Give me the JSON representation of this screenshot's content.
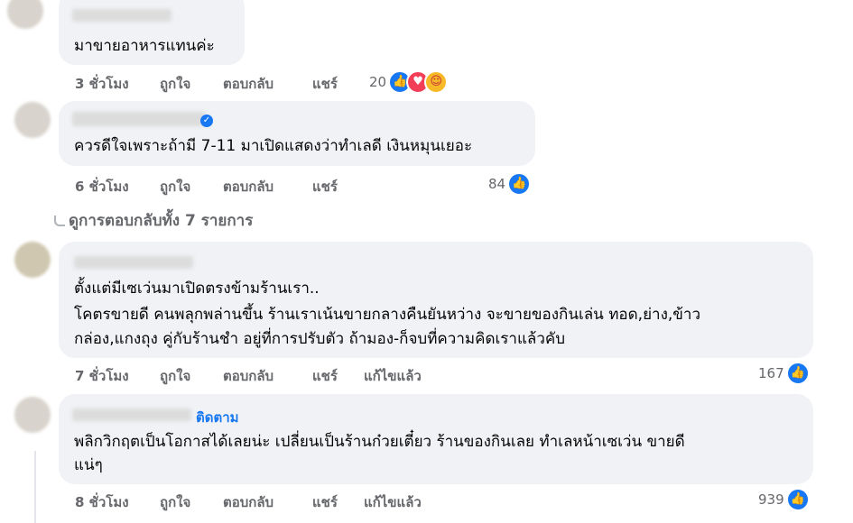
{
  "colors": {
    "link": "#1877f2",
    "muted": "#65676b",
    "bubble": "#f0f2f5",
    "like": "#1877f2",
    "love": "#f33e58",
    "care": "#f7b928"
  },
  "comments": [
    {
      "text_lines": [
        "มาขายอาหารแทนค่ะ"
      ],
      "actions": {
        "time": "3 ชั่วโมง",
        "like": "ถูกใจ",
        "reply": "ตอบกลับ",
        "share": "แชร์"
      },
      "reactions": {
        "count": "20",
        "icons": [
          "like-icon",
          "love-icon",
          "care-icon"
        ]
      }
    },
    {
      "text_lines": [
        "ควรดีใจเพราะถ้ามี 7-11 มาเปิดแสดงว่าทำเลดี เงินหมุนเยอะ"
      ],
      "actions": {
        "time": "6 ชั่วโมง",
        "like": "ถูกใจ",
        "reply": "ตอบกลับ",
        "share": "แชร์"
      },
      "reactions": {
        "count": "84",
        "icons": [
          "like-icon"
        ]
      }
    },
    {
      "text_lines": [
        "ตั้งแต่มีเซเว่นมาเปิดตรงข้ามร้านเรา..",
        "โคตรขายดี คนพลุกพล่านขึ้น ร้านเราเน้นขายกลางคืนยันหว่าง จะขายของกินเล่น ทอด,ย่าง,ข้าว",
        "กล่อง,แกงถุง คู่กับร้านชำ อยู่ที่การปรับตัว ถ้ามอง-ก็จบที่ความคิดเราแล้วคับ"
      ],
      "actions": {
        "time": "7 ชั่วโมง",
        "like": "ถูกใจ",
        "reply": "ตอบกลับ",
        "share": "แชร์",
        "edited": "แก้ไขแล้ว"
      },
      "reactions": {
        "count": "167",
        "icons": [
          "like-icon"
        ]
      }
    },
    {
      "follow_label": "ติดตาม",
      "text_lines": [
        "พลิกวิกฤตเป็นโอกาสได้เลยน่ะ เปลี่ยนเป็นร้านก๋วยเตี๋ยว ร้านของกินเลย ทำเลหน้าเซเว่น ขายดี",
        "แน่ๆ"
      ],
      "actions": {
        "time": "8 ชั่วโมง",
        "like": "ถูกใจ",
        "reply": "ตอบกลับ",
        "share": "แชร์",
        "edited": "แก้ไขแล้ว"
      },
      "reactions": {
        "count": "939",
        "icons": [
          "like-icon"
        ]
      }
    }
  ],
  "view_replies": "ดูการตอบกลับทั้ง 7 รายการ"
}
